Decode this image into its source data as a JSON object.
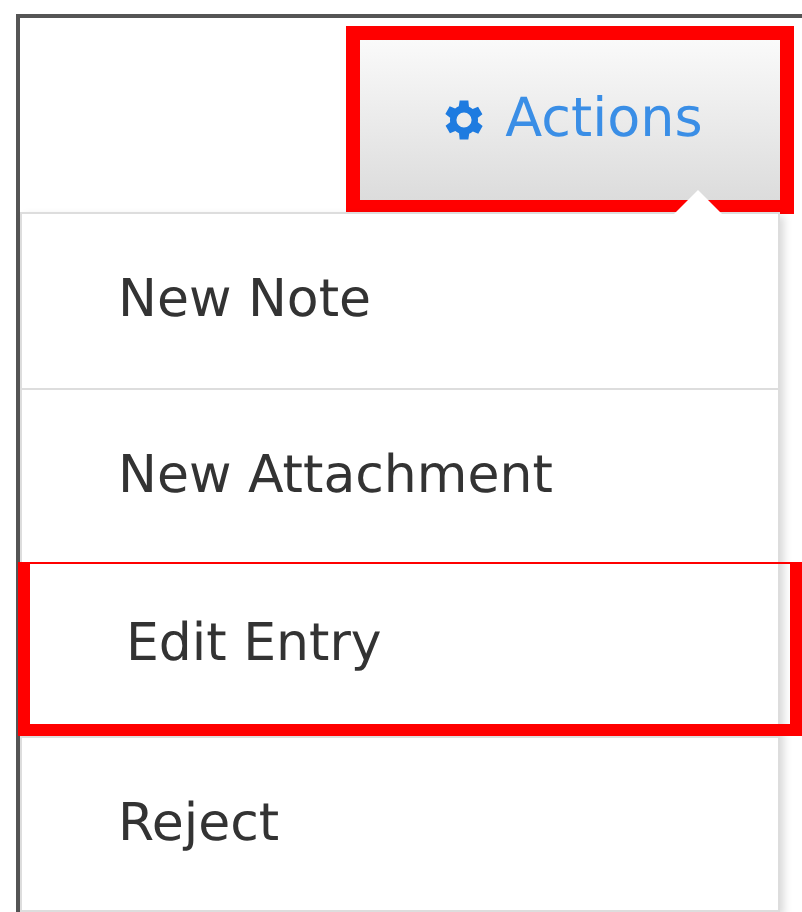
{
  "actions_button": {
    "label": "Actions",
    "highlighted": true
  },
  "menu": [
    {
      "label": "New Note",
      "highlighted": false
    },
    {
      "label": "New Attachment",
      "highlighted": false
    },
    {
      "label": "Edit Entry",
      "highlighted": true
    },
    {
      "label": "Reject",
      "highlighted": false
    }
  ]
}
